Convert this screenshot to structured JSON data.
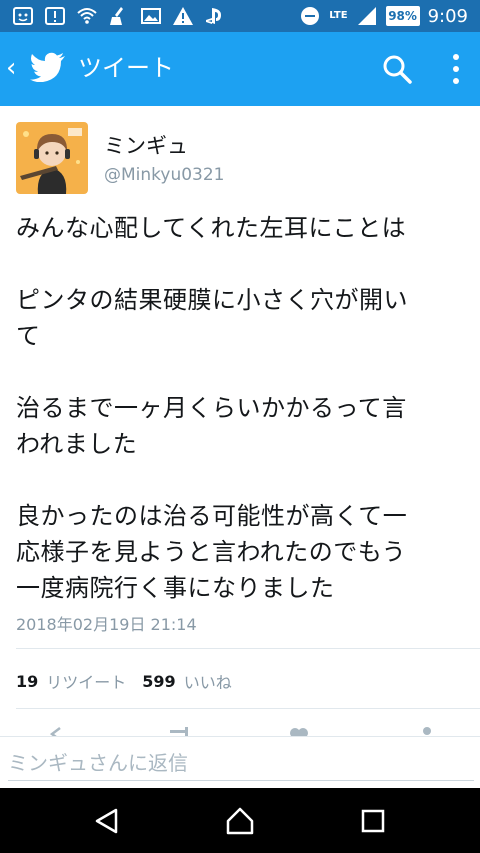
{
  "status_bar": {
    "lte": "LTE",
    "battery": "98%",
    "time": "9:09"
  },
  "app_bar": {
    "title": "ツイート"
  },
  "tweet": {
    "display_name": "ミンギュ",
    "handle": "@Minkyu0321",
    "text": "みんな心配してくれた左耳にことは\n\nピンタの結果硬膜に小さく穴が開い\nて\n\n治るまで一ヶ月くらいかかるって言\nわれました\n\n良かったのは治る可能性が高くて一\n応様子を見ようと言われたのでもう\n一度病院行く事になりました",
    "timestamp": "2018年02月19日 21:14",
    "retweet_count": "19",
    "retweet_label": "リツイート",
    "like_count": "599",
    "like_label": "いいね"
  },
  "reply": {
    "placeholder": "ミンギュさんに返信"
  },
  "colors": {
    "status_bar": "#1c6fb0",
    "app_bar": "#1da1f2",
    "text": "#14171a",
    "muted": "#8899a6"
  }
}
